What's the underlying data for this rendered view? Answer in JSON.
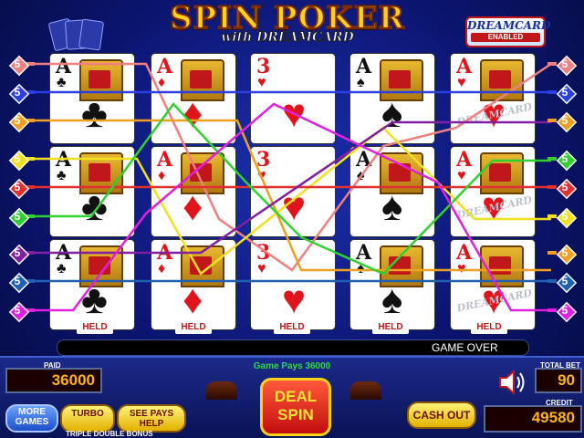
{
  "game": {
    "title": "SPIN POKER",
    "subtitle": "with DREAMCARD",
    "badge_brand": "DREAMCARD",
    "badge_text": "ENABLED"
  },
  "card_rows": [
    [
      {
        "rank": "A",
        "suit": "♣",
        "color": "black"
      },
      {
        "rank": "A",
        "suit": "♦",
        "color": "red"
      },
      {
        "rank": "3",
        "suit": "♥",
        "color": "red"
      },
      {
        "rank": "A",
        "suit": "♠",
        "color": "black"
      },
      {
        "rank": "A",
        "suit": "♥",
        "color": "red",
        "dream": true
      }
    ],
    [
      {
        "rank": "A",
        "suit": "♣",
        "color": "black"
      },
      {
        "rank": "A",
        "suit": "♦",
        "color": "red"
      },
      {
        "rank": "3",
        "suit": "♥",
        "color": "red"
      },
      {
        "rank": "A",
        "suit": "♠",
        "color": "black"
      },
      {
        "rank": "A",
        "suit": "♥",
        "color": "red",
        "dream": true
      }
    ],
    [
      {
        "rank": "A",
        "suit": "♣",
        "color": "black"
      },
      {
        "rank": "A",
        "suit": "♦",
        "color": "red"
      },
      {
        "rank": "3",
        "suit": "♥",
        "color": "red"
      },
      {
        "rank": "A",
        "suit": "♠",
        "color": "black"
      },
      {
        "rank": "A",
        "suit": "♥",
        "color": "red",
        "dream": true
      }
    ]
  ],
  "dream_watermark": "DREAMCARD",
  "held_label": "HELD",
  "held_columns": [
    0,
    1,
    2,
    3,
    4
  ],
  "payline_buttons_left": [
    {
      "label": "5",
      "color": "#f08080"
    },
    {
      "label": "5",
      "color": "#2b3fe0"
    },
    {
      "label": "5",
      "color": "#f0a020"
    },
    {
      "label": "5",
      "color": "#f0e020"
    },
    {
      "label": "5",
      "color": "#e03030"
    },
    {
      "label": "5",
      "color": "#30d030"
    },
    {
      "label": "5",
      "color": "#8020a0"
    },
    {
      "label": "5",
      "color": "#2060b0"
    },
    {
      "label": "5",
      "color": "#e020e0"
    }
  ],
  "payline_buttons_right": [
    {
      "label": "5",
      "color": "#f08080"
    },
    {
      "label": "5",
      "color": "#2b3fe0"
    },
    {
      "label": "5",
      "color": "#f0a020"
    },
    {
      "label": "5",
      "color": "#30d030"
    },
    {
      "label": "5",
      "color": "#e03030"
    },
    {
      "label": "5",
      "color": "#f0e020"
    },
    {
      "label": "5",
      "color": "#f0a020"
    },
    {
      "label": "5",
      "color": "#2060b0"
    },
    {
      "label": "5",
      "color": "#e020e0"
    }
  ],
  "status": {
    "message": "GAME OVER",
    "game_pays": "Game Pays 36000"
  },
  "meters": {
    "paid_label": "PAID",
    "paid_value": "36000",
    "total_bet_label": "TOTAL BET",
    "total_bet_value": "90",
    "credit_label": "CREDIT",
    "credit_value": "49580"
  },
  "buttons": {
    "more_games": "MORE GAMES",
    "turbo": "TURBO",
    "see_pays": "SEE PAYS HELP",
    "deal_spin": "DEAL SPIN",
    "cash_out": "CASH OUT"
  },
  "footer_text": "TRIPLE DOUBLE BONUS",
  "colors": {
    "gold": "#ffd21a",
    "meter_text": "#ffb21a",
    "held_red": "#c0181a",
    "pays_green": "#2fd840"
  },
  "icons": {
    "sound": "speaker-icon"
  }
}
